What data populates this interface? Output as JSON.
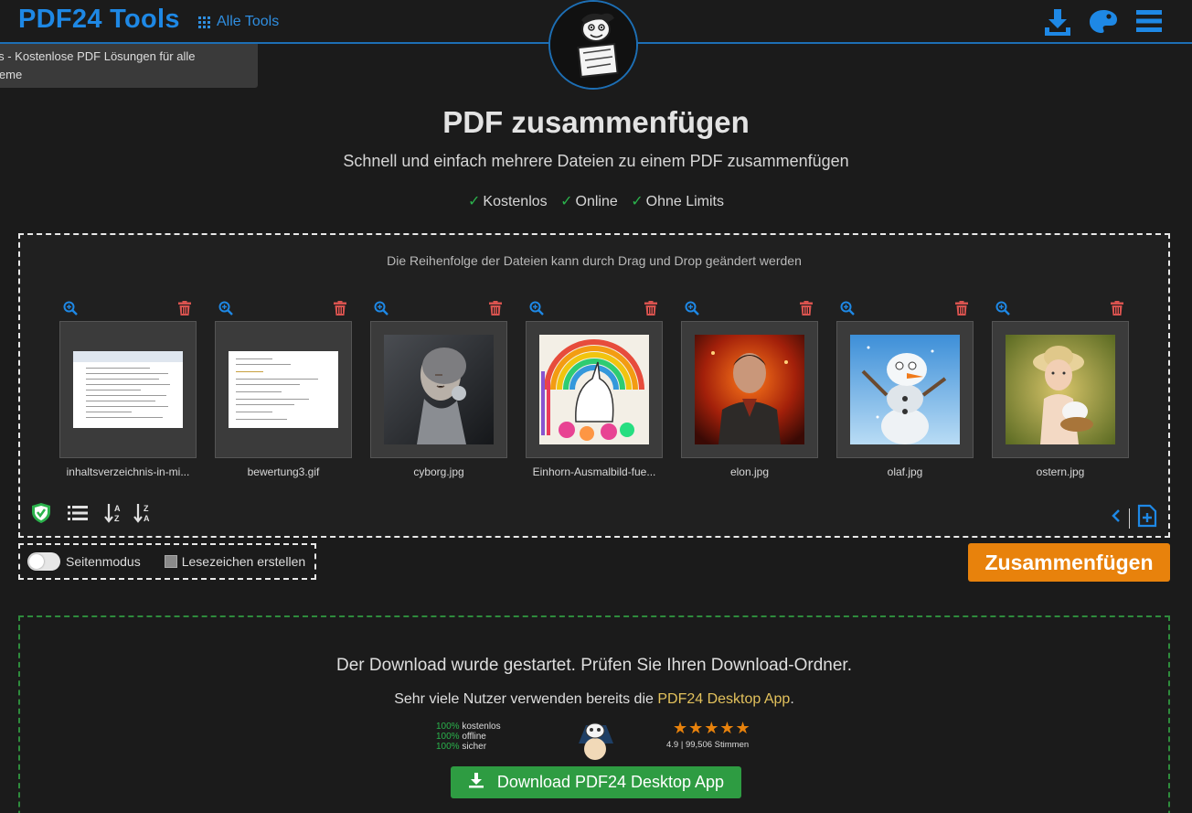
{
  "header": {
    "brand": "PDF24 Tools",
    "all_tools_label": "Alle Tools",
    "icons": [
      "download-icon",
      "palette-icon",
      "menu-icon"
    ],
    "tooltip_line1": "ols - Kostenlose PDF Lösungen für alle",
    "tooltip_line2": "leme"
  },
  "page": {
    "title": "PDF zusammenfügen",
    "subtitle": "Schnell und einfach mehrere Dateien zu einem PDF zusammenfügen",
    "features": [
      "Kostenlos",
      "Online",
      "Ohne Limits"
    ],
    "check_mark": "✓"
  },
  "dropzone": {
    "hint": "Die Reihenfolge der Dateien kann durch Drag und Drop geändert werden",
    "files": [
      {
        "name": "inhaltsverzeichnis-in-mi...",
        "kind": "document"
      },
      {
        "name": "bewertung3.gif",
        "kind": "document"
      },
      {
        "name": "cyborg.jpg",
        "kind": "image"
      },
      {
        "name": "Einhorn-Ausmalbild-fue...",
        "kind": "image"
      },
      {
        "name": "elon.jpg",
        "kind": "image"
      },
      {
        "name": "olaf.jpg",
        "kind": "image"
      },
      {
        "name": "ostern.jpg",
        "kind": "image"
      }
    ],
    "left_tools": [
      "shield-check-icon",
      "list-icon",
      "sort-az-icon",
      "sort-za-icon"
    ],
    "right_tools": [
      "chevron-left-icon",
      "add-file-icon"
    ]
  },
  "options": {
    "page_mode_label": "Seitenmodus",
    "page_mode_on": false,
    "bookmarks_label": "Lesezeichen erstellen",
    "bookmarks_checked": false
  },
  "merge_button": "Zusammenfügen",
  "download": {
    "message": "Der Download wurde gestartet. Prüfen Sie Ihren Download-Ordner.",
    "sub_prefix": "Sehr viele Nutzer verwenden bereits die ",
    "sub_link": "PDF24 Desktop App",
    "sub_suffix": ".",
    "stats": [
      {
        "pct": "100%",
        "label": "kostenlos"
      },
      {
        "pct": "100%",
        "label": "offline"
      },
      {
        "pct": "100%",
        "label": "sicher"
      }
    ],
    "stars": "★★★★★",
    "rating": "4.9 | 99,506 Stimmen",
    "button": "Download PDF24 Desktop App"
  },
  "colors": {
    "accent_blue": "#1e88e5",
    "merge_orange": "#e8820c",
    "download_green": "#2e9c42",
    "delete_red": "#d9534f"
  }
}
